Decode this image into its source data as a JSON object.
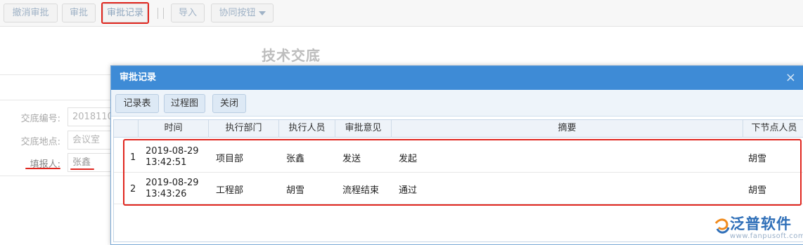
{
  "toolbar": {
    "cancel_approve": "撤消审批",
    "approve": "审批",
    "approval_record": "审批记录",
    "import": "导入",
    "collab": "协同按钮"
  },
  "form": {
    "title": "技术交底",
    "fields": [
      {
        "label": "交底编号:",
        "value": "2018110"
      },
      {
        "label": "交底地点:",
        "value": "会议室"
      },
      {
        "label": "填报人:",
        "value": "张鑫"
      }
    ]
  },
  "dialog": {
    "title": "审批记录",
    "close": "×",
    "buttons": {
      "record_table": "记录表",
      "process_chart": "过程图",
      "close": "关闭"
    },
    "columns": [
      "时间",
      "执行部门",
      "执行人员",
      "审批意见",
      "摘要",
      "下节点人员"
    ],
    "rows": [
      {
        "index": "1",
        "date": "2019-08-29",
        "time": "13:42:51",
        "dept": "项目部",
        "person": "张鑫",
        "opinion": "发送",
        "summary": "发起",
        "next": "胡雪"
      },
      {
        "index": "2",
        "date": "2019-08-29",
        "time": "13:43:26",
        "dept": "工程部",
        "person": "胡雪",
        "opinion": "流程结束",
        "summary": "通过",
        "next": "胡雪"
      }
    ]
  },
  "watermark": {
    "brand": "泛普软件",
    "url": "www.fanpusoft.com"
  },
  "colors": {
    "accent": "#3e8bd6",
    "highlight": "#e0261f",
    "brand": "#2f6fb8"
  }
}
